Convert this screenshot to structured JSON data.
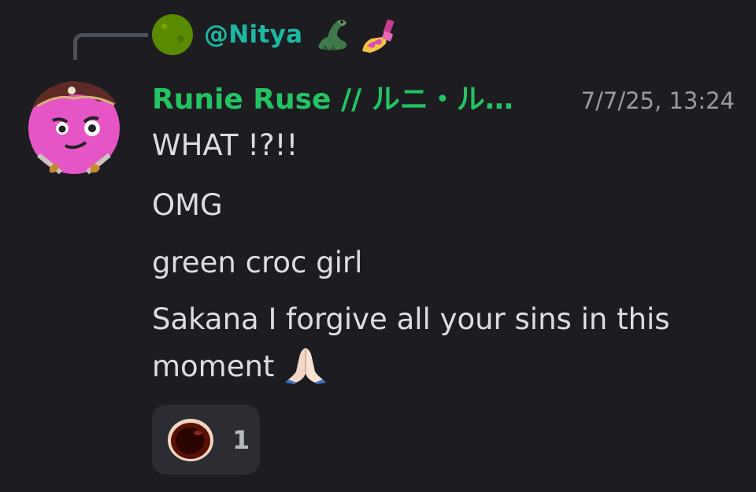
{
  "reply": {
    "username": "@Nitya",
    "emoji_icons": [
      "crocodile-icon",
      "nail-polish-icon"
    ]
  },
  "message": {
    "author": "Runie Ruse // ルニ・ル…",
    "timestamp": "7/7/25, 13:24",
    "lines": [
      "WHAT !?!!",
      "OMG",
      "green croc girl",
      "Sakana I forgive all your sins in this moment"
    ],
    "trailing_emoji_icon": "praying-hands-icon"
  },
  "reaction": {
    "emoji_icon": "custom-hole-emoji-icon",
    "count": "1"
  },
  "colors": {
    "background": "#1c1c21",
    "reply_name": "#1cb8a3",
    "author_name": "#23c462",
    "timestamp": "#9a9ca3",
    "text": "#dbdee1",
    "reaction_bg": "#2b2d33"
  }
}
